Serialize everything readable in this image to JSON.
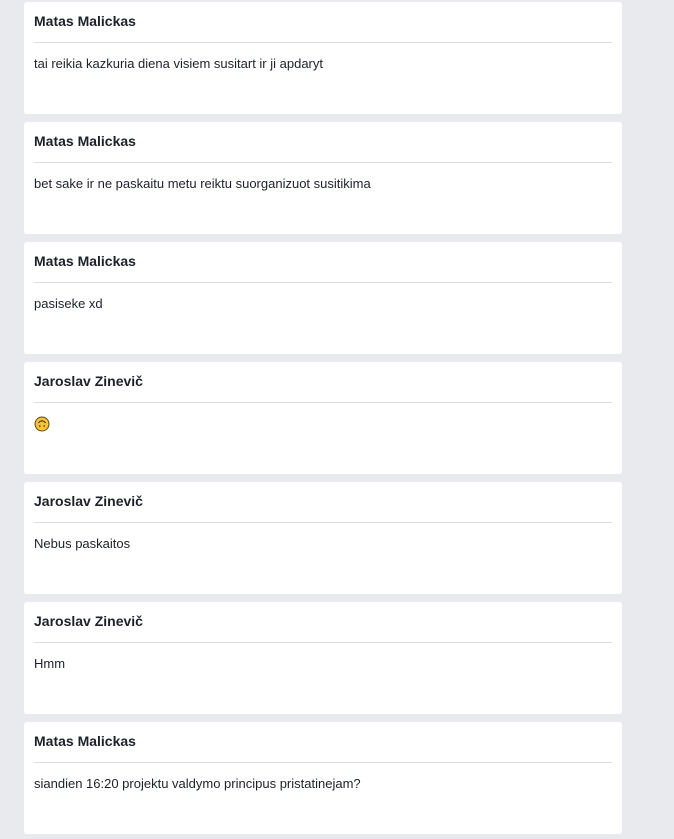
{
  "posts": [
    {
      "author": "Matas Malickas",
      "message": "tai reikia kazkuria diena visiem susitart ir ji apdaryt"
    },
    {
      "author": "Matas Malickas",
      "message": "bet sake ir ne paskaitu metu reiktu suorganizuot susitikima"
    },
    {
      "author": "Matas Malickas",
      "message": "pasiseke xd"
    },
    {
      "author": "Jaroslav Zinevič",
      "message": "",
      "emoji": "upside-down-face-icon"
    },
    {
      "author": "Jaroslav Zinevič",
      "message": "Nebus paskaitos"
    },
    {
      "author": "Jaroslav Zinevič",
      "message": "Hmm"
    },
    {
      "author": "Matas Malickas",
      "message": "siandien 16:20 projektu valdymo principus pristatinejam?"
    }
  ],
  "colors": {
    "page_background": "#e9eaed",
    "card_background": "#ffffff",
    "text": "#1d2129",
    "divider": "#dadde1",
    "emoji_fill": "#f7c439",
    "emoji_stroke": "#5b4a16"
  }
}
